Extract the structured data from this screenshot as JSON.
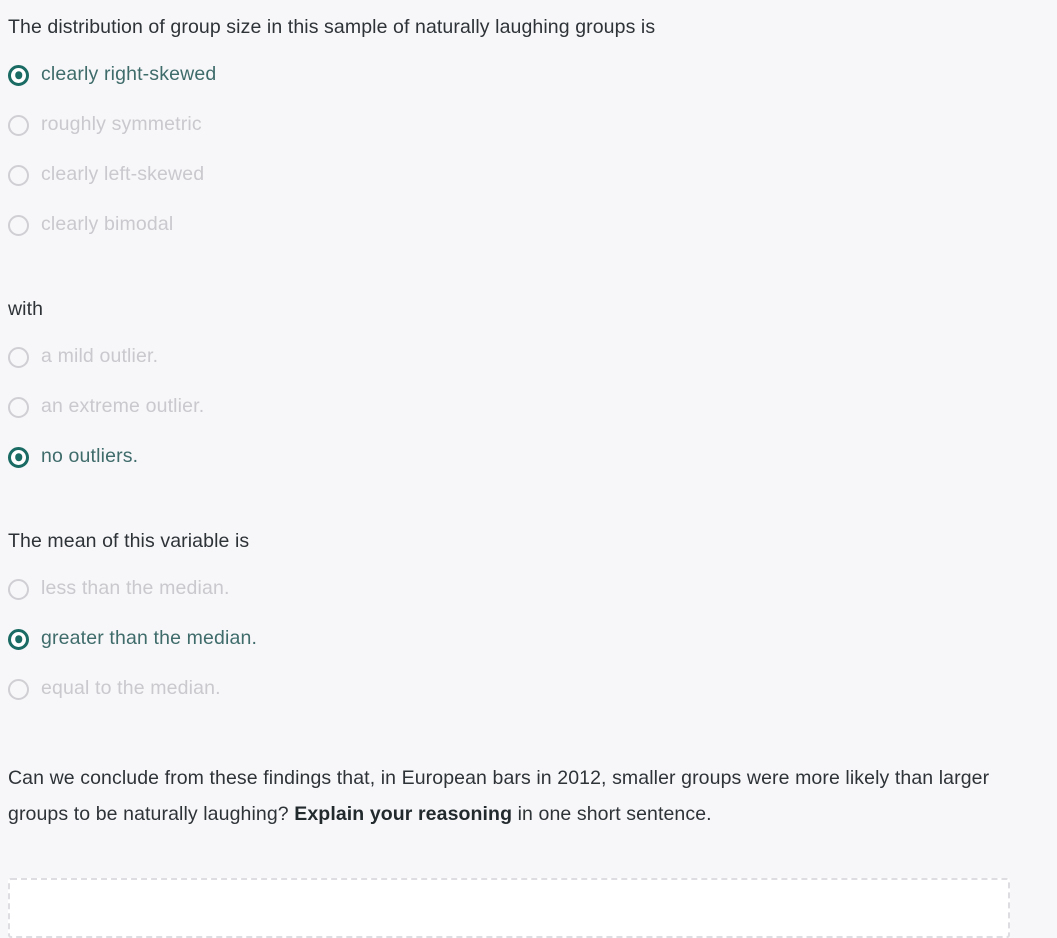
{
  "theme": {
    "background": "#f7f7f9",
    "stem_text": "#2e3338",
    "selected_accent": "#1a6b63",
    "selected_label": "#3f6c6b",
    "unselected_label": "#c9c9ce",
    "unselected_ring": "#cfcfd4",
    "answer_border": "#dddde2"
  },
  "questions": [
    {
      "stem": "The distribution of group size in this sample of naturally laughing groups is",
      "options": [
        {
          "label": "clearly right-skewed",
          "selected": true
        },
        {
          "label": "roughly symmetric",
          "selected": false
        },
        {
          "label": "clearly left-skewed",
          "selected": false
        },
        {
          "label": "clearly bimodal",
          "selected": false
        }
      ]
    },
    {
      "stem": "with",
      "options": [
        {
          "label": "a mild outlier.",
          "selected": false
        },
        {
          "label": "an extreme outlier.",
          "selected": false
        },
        {
          "label": "no outliers.",
          "selected": true
        }
      ]
    },
    {
      "stem": "The mean of this variable is",
      "options": [
        {
          "label": "less than the median.",
          "selected": false
        },
        {
          "label": "greater than the median.",
          "selected": true
        },
        {
          "label": "equal to the median.",
          "selected": false
        }
      ]
    }
  ],
  "closing": {
    "part_1": "Can we conclude from these findings that, in European bars in 2012, smaller groups were more likely than larger groups to be naturally laughing? ",
    "emphasis": "Explain your reasoning",
    "part_2": " in one short sentence."
  },
  "answer": {
    "value": "",
    "placeholder": ""
  }
}
